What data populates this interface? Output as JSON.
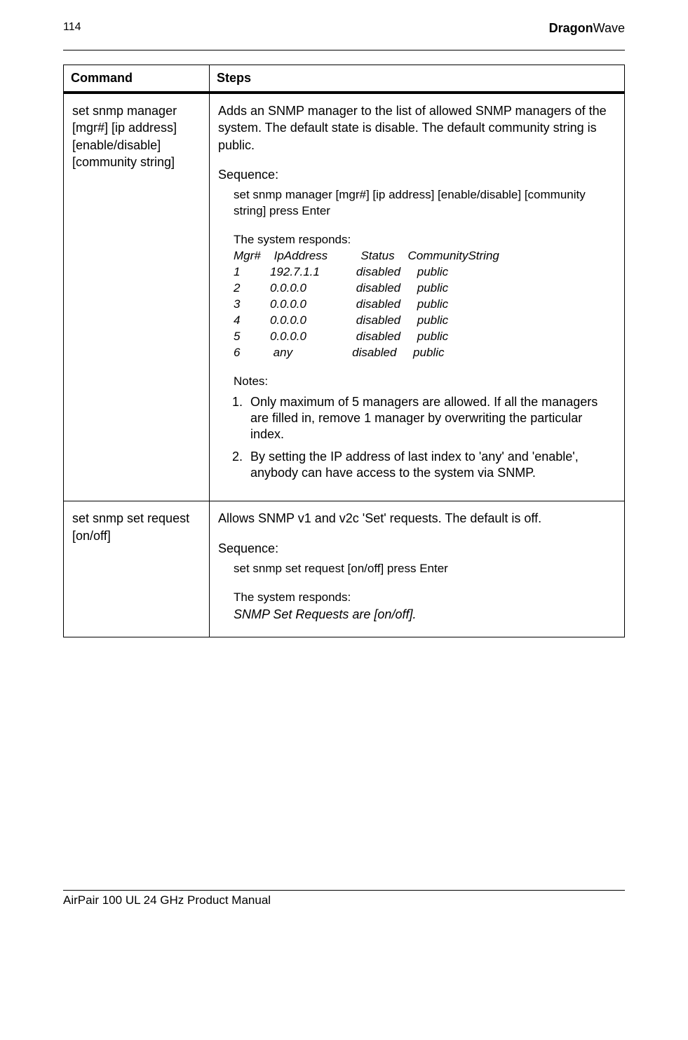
{
  "header": {
    "page_number": "114",
    "brand_bold": "Dragon",
    "brand_rest": "Wave"
  },
  "table": {
    "head_command": "Command",
    "head_steps": "Steps",
    "rows": [
      {
        "command": "set snmp manager [mgr#] [ip address] [enable/disable] [community string]",
        "intro": "Adds an SNMP manager to the list of allowed SNMP managers of the system. The default state is disable. The default community string is public.",
        "sequence_label": "Sequence:",
        "sequence_text": "set snmp manager [mgr#] [ip address] [enable/disable] [community string] press Enter",
        "responds_label": "The system responds:",
        "response_lines": [
          "Mgr#    IpAddress          Status    CommunityString",
          "1         192.7.1.1           disabled     public",
          "2         0.0.0.0               disabled     public",
          "3         0.0.0.0               disabled     public",
          "4         0.0.0.0               disabled     public",
          "5         0.0.0.0               disabled     public",
          "6          any                  disabled     public"
        ],
        "notes_label": "Notes:",
        "notes": [
          "Only maximum of 5 managers are allowed. If all the managers are filled in, remove 1 manager by overwriting the particular index.",
          "By setting the IP address of last index to 'any' and 'enable', anybody can have access to the system via SNMP."
        ]
      },
      {
        "command": "set snmp set request [on/off]",
        "intro": "Allows SNMP v1 and v2c 'Set' requests. The default is off.",
        "sequence_label": "Sequence:",
        "sequence_text": "set snmp set request [on/off] press Enter",
        "responds_label": "The system responds:",
        "response_line": "SNMP Set Requests are [on/off]."
      }
    ]
  },
  "footer": {
    "text": "AirPair 100 UL 24 GHz Product Manual"
  }
}
